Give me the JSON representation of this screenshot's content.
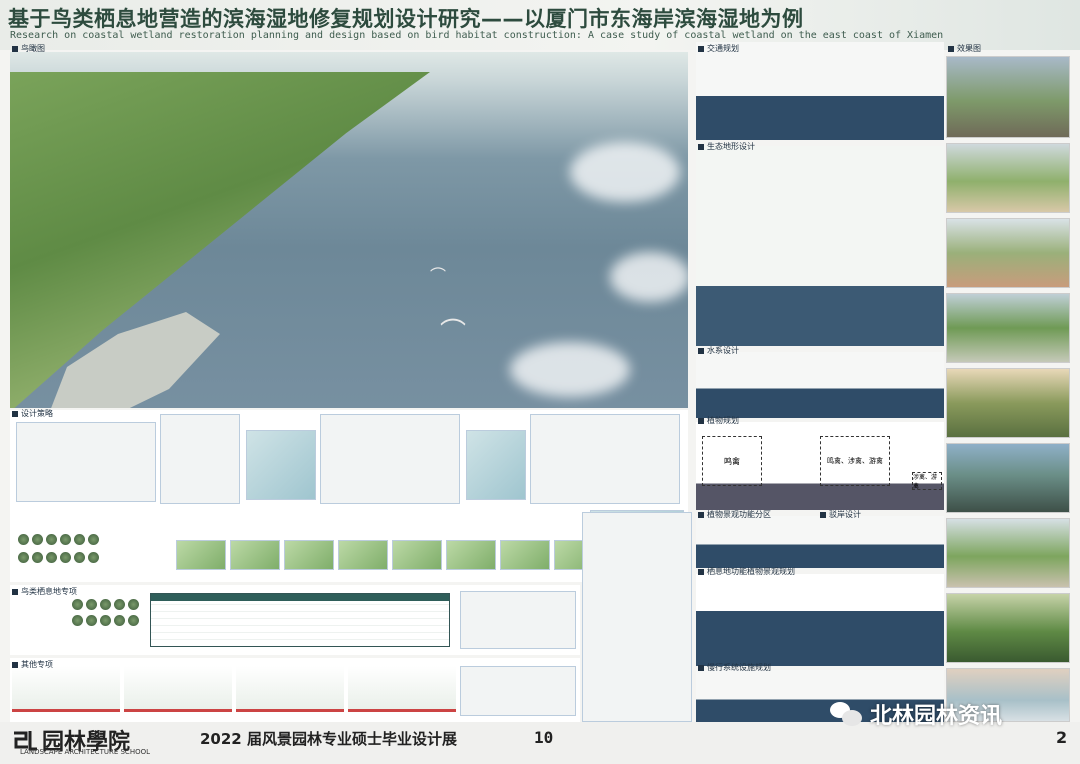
{
  "header": {
    "title_cn": "基于鸟类栖息地营造的滨海湿地修复规划设计研究——以厦门市东海岸滨海湿地为例",
    "title_en": "Research on coastal wetland restoration planning and design based on bird habitat construction: A case study of coastal wetland on the east coast of Xiamen"
  },
  "sections": {
    "aerial": "鸟瞰图",
    "strategy": "设计策略",
    "bird_habitat": "鸟类栖息地专项",
    "other": "其他专项",
    "traffic": "交通规划",
    "topography": "生态地形设计",
    "water": "水系设计",
    "planting": "植物规划",
    "plant_zones": "植物景观功能分区",
    "embankment": "驳岸设计",
    "habitat_planting": "栖息地功能植物景观规划",
    "trails": "慢行系统设施规划",
    "effects": "效果图"
  },
  "planting_labels": {
    "a": "鸣禽",
    "b": "鸣禽、涉禽、游禽",
    "c": "涉禽、游禽"
  },
  "footer": {
    "school_cn": "园林學院",
    "school_en": "LANDSCAPE ARCHITECTURE SCHOOL",
    "exhibition": "2022 届风景园林专业硕士毕业设计展",
    "page": "10",
    "page_right": "2"
  },
  "watermark": {
    "text": "北林园林资讯"
  },
  "colors": {
    "title": "#2d4b3e",
    "sea": "#2f4c68",
    "accent_red": "#c44444",
    "dark_teal": "#2f5e5a"
  },
  "icons": [
    "square-bullet-icon",
    "wechat-icon",
    "bird-icon",
    "school-logo-icon"
  ]
}
